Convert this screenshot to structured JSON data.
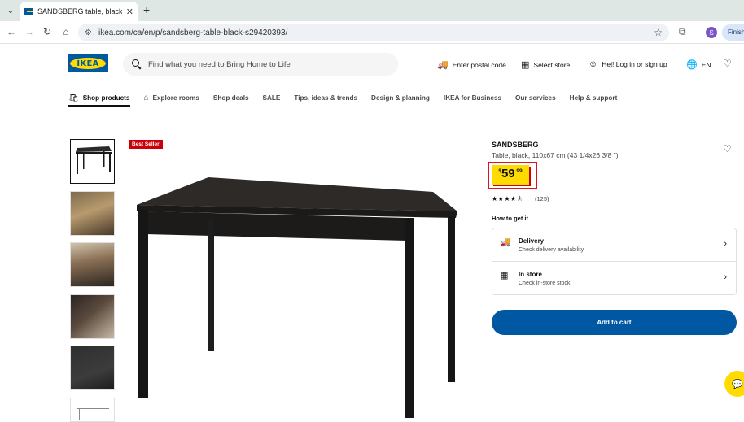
{
  "browser": {
    "tab_title": "SANDSBERG table, black, 110x67 cm",
    "tab_close": "✕",
    "new_tab": "+",
    "url": "ikea.com/ca/en/p/sandsberg-table-black-s29420393/",
    "profile_initial": "S",
    "finish_label": "Finish"
  },
  "header": {
    "logo_text": "IKEA",
    "search_placeholder": "Find what you need to Bring Home to Life",
    "postal_code": "Enter postal code",
    "select_store": "Select store",
    "login": "Hej! Log in or sign up",
    "language": "EN"
  },
  "nav": {
    "items": [
      "Shop products",
      "Explore rooms",
      "Shop deals",
      "SALE",
      "Tips, ideas & trends",
      "Design & planning",
      "IKEA for Business",
      "Our services",
      "Help & support"
    ]
  },
  "product": {
    "badge": "Best Seller",
    "name": "SANDSBERG",
    "description": "Table, black, 110x67 cm (43 1/4x26 3/8 \")",
    "price_currency": "$",
    "price_integer": "59",
    "price_decimal": ".99",
    "rating": 4.5,
    "stars": "★★★★⯪",
    "review_count": "(125)",
    "how_to_get": "How to get it",
    "delivery_title": "Delivery",
    "delivery_sub": "Check delivery availability",
    "instore_title": "In store",
    "instore_sub": "Check in-store stock",
    "add_to_cart": "Add to cart"
  },
  "colors": {
    "ikea_blue": "#0058a3",
    "ikea_yellow": "#ffdb00",
    "badge_red": "#cc0008",
    "highlight_red": "#e0101e"
  }
}
